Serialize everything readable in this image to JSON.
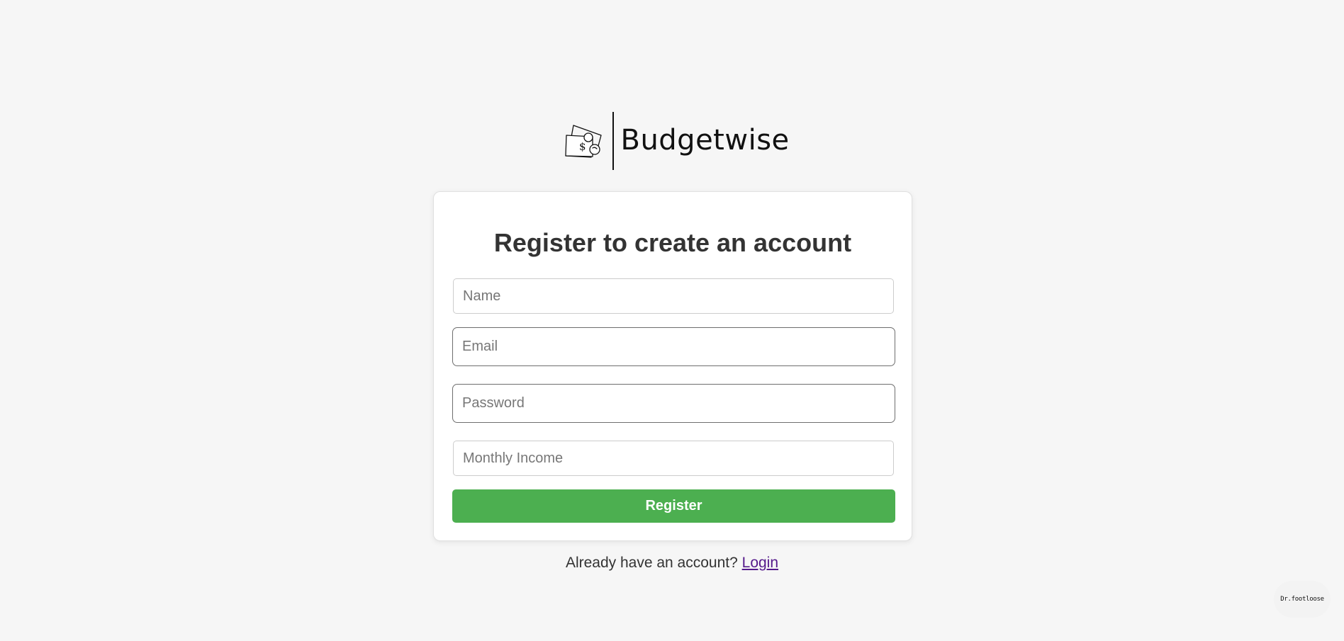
{
  "brand": {
    "name": "Budgetwise",
    "icon": "money-bills-coins-icon"
  },
  "form": {
    "title": "Register to create an account",
    "name_placeholder": "Name",
    "email_placeholder": "Email",
    "password_placeholder": "Password",
    "income_placeholder": "Monthly Income",
    "submit_label": "Register"
  },
  "footer": {
    "prompt": "Already have an account?",
    "login_label": "Login"
  },
  "corner_badge": {
    "text": "Dr.footloose"
  },
  "colors": {
    "background": "#f6f6f6",
    "primary_button": "#4caf50",
    "link_visited": "#551a8b",
    "title_text": "#333333"
  }
}
